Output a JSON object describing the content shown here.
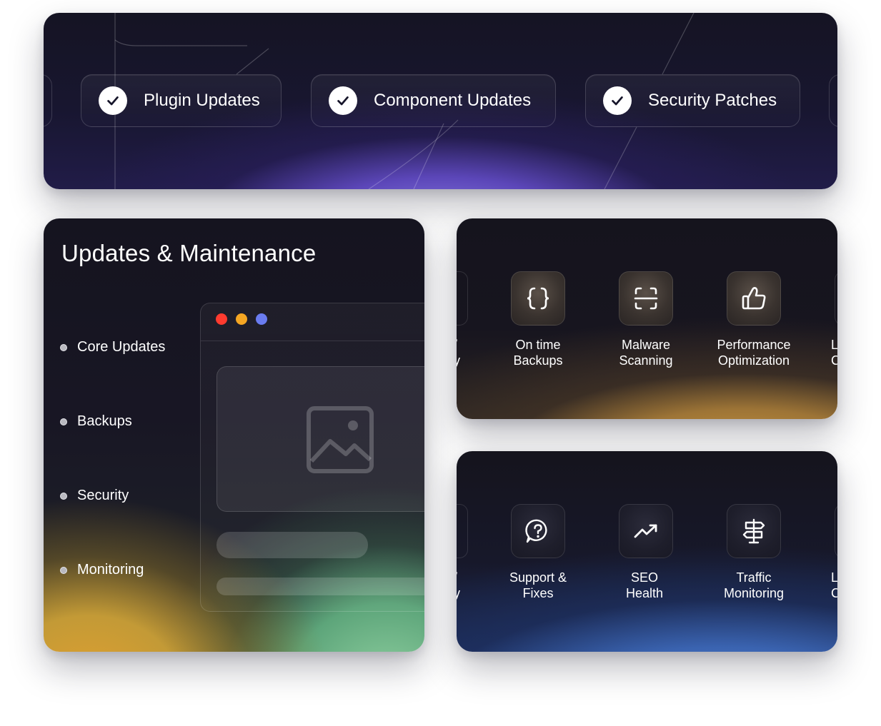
{
  "banner": {
    "pills": [
      {
        "label": "Plugin Updates"
      },
      {
        "label": "Component Updates"
      },
      {
        "label": "Security Patches"
      }
    ]
  },
  "updates": {
    "title": "Updates & Maintenance",
    "items": [
      {
        "label": "Core Updates"
      },
      {
        "label": "Backups"
      },
      {
        "label": "Security"
      },
      {
        "label": "Monitoring"
      }
    ],
    "window_dots": [
      "#ff3b2f",
      "#f5a623",
      "#6a7cf0"
    ]
  },
  "features_a": {
    "left_fragment": [
      "/",
      "y"
    ],
    "items": [
      {
        "icon": "braces-icon",
        "line1": "On time",
        "line2": "Backups"
      },
      {
        "icon": "scan-icon",
        "line1": "Malware",
        "line2": "Scanning"
      },
      {
        "icon": "thumbs-up-icon",
        "line1": "Performance",
        "line2": "Optimization"
      }
    ],
    "right_fragment": [
      "L",
      "C"
    ]
  },
  "features_b": {
    "left_fragment": [
      "/",
      "y"
    ],
    "items": [
      {
        "icon": "help-chat-icon",
        "line1": "Support &",
        "line2": "Fixes"
      },
      {
        "icon": "trending-up-icon",
        "line1": "SEO",
        "line2": "Health"
      },
      {
        "icon": "signpost-icon",
        "line1": "Traffic",
        "line2": "Monitoring"
      }
    ],
    "right_fragment": [
      "L",
      "C"
    ]
  }
}
